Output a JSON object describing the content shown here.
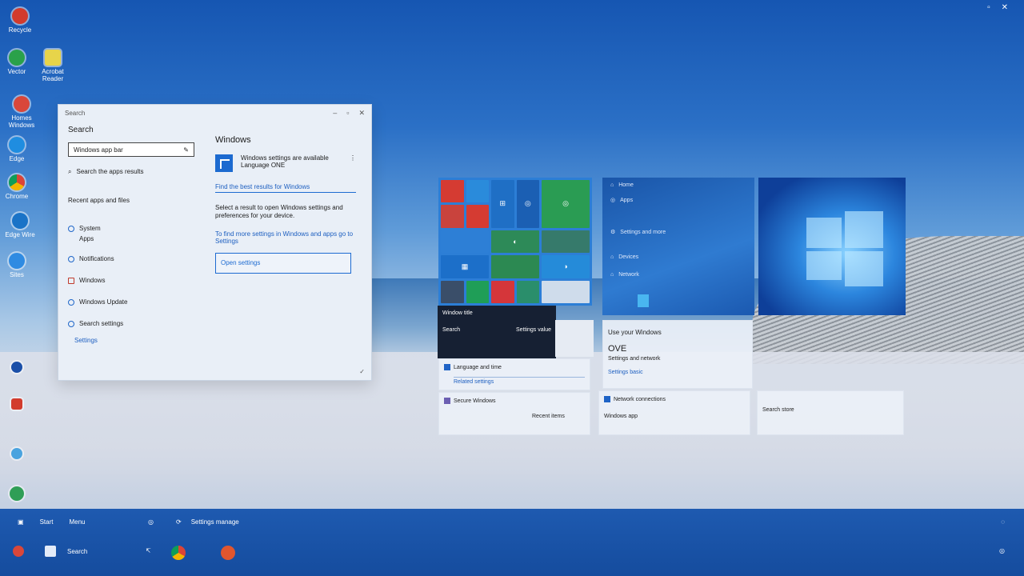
{
  "tray": {
    "items": [
      "▫",
      "✕"
    ]
  },
  "desktop_icons": [
    {
      "label": "Recycle"
    },
    {
      "label": "Vector"
    },
    {
      "label": "Acrobat Reader"
    },
    {
      "label": "Homes Windows"
    },
    {
      "label": "Edge"
    },
    {
      "label": "Chrome"
    },
    {
      "label": "Edge Wire"
    },
    {
      "label": "Sites"
    }
  ],
  "search_window": {
    "title": "Search",
    "heading": "Search",
    "search_value": "Windows app bar",
    "results_label": "Search the apps results",
    "section2": "Recent apps and files",
    "nav": [
      "System",
      "Apps",
      "Notifications",
      "Windows",
      "Windows Update",
      "Search settings",
      "Settings"
    ],
    "right_title": "Windows",
    "app_name": "Windows settings are available",
    "app_sub": "Language ONE",
    "link_line": "Find the best results for Windows",
    "desc": "Select a result to open Windows settings and preferences for your device.",
    "link2": "To find more settings in Windows and apps go to Settings",
    "button_label": "Open settings"
  },
  "dark_popup": {
    "title": "Window title",
    "left": "Search",
    "right": "Settings value"
  },
  "panel_left": {
    "items": [
      "Home",
      "Apps",
      "Settings and more",
      "Devices",
      "Network"
    ]
  },
  "info_card": {
    "line1": "Use your Windows",
    "line2": "OVE",
    "line3": "Settings and network",
    "link": "Settings basic"
  },
  "bottom_cards": [
    {
      "title": "Language and time",
      "sub": "Related settings"
    },
    {
      "title": "Secure Windows",
      "sub": "Recent items"
    },
    {
      "title": "Network connections",
      "sub": "Windows app"
    },
    {
      "title": "Search store",
      "sub": ""
    }
  ],
  "taskbar": {
    "start_label": "Start",
    "task_label": "Menu",
    "settings_label": "Settings manage",
    "app_label": "Search"
  }
}
